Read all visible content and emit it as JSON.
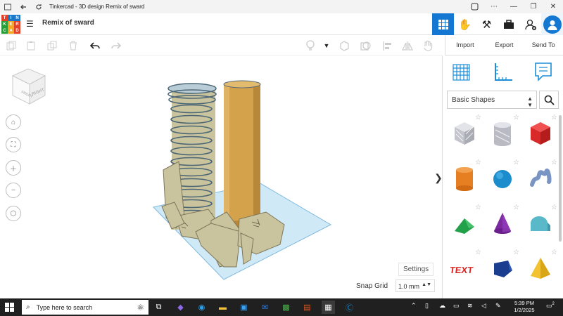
{
  "window": {
    "title": "Tinkercad - 3D design Remix of sward",
    "back_icon": "arrow-left-icon",
    "refresh_icon": "refresh-icon"
  },
  "logo": {
    "letters": [
      "T",
      "I",
      "N",
      "K",
      "E",
      "R",
      "C",
      "A",
      "D"
    ],
    "colors": [
      "#e2412a",
      "#1d77c8",
      "#1d77c8",
      "#2a9d3a",
      "#f5a623",
      "#e2412a",
      "#2a9d3a",
      "#f5a623",
      "#e2412a"
    ]
  },
  "header": {
    "design_name": "Remix of sward",
    "menu_icon": "list-menu-icon",
    "accent": "#1477d1"
  },
  "panel": {
    "tabs": [
      "Import",
      "Export",
      "Send To"
    ],
    "category": "Basic Shapes",
    "shapes": [
      "box-hole",
      "cylinder-hole",
      "box",
      "cylinder",
      "sphere",
      "scribble",
      "roof",
      "cone",
      "round-roof",
      "text",
      "polygon",
      "pyramid"
    ]
  },
  "canvas": {
    "viewcube_labels": [
      "RIGHT",
      "FRONT"
    ],
    "settings_label": "Settings",
    "snap_grid_label": "Snap Grid",
    "snap_grid_value": "1.0 mm",
    "collapse_glyph": "❯"
  },
  "taskbar": {
    "search_placeholder": "Type here to search",
    "time": "5:39 PM",
    "date": "1/2/2025",
    "notification_count": "2"
  }
}
